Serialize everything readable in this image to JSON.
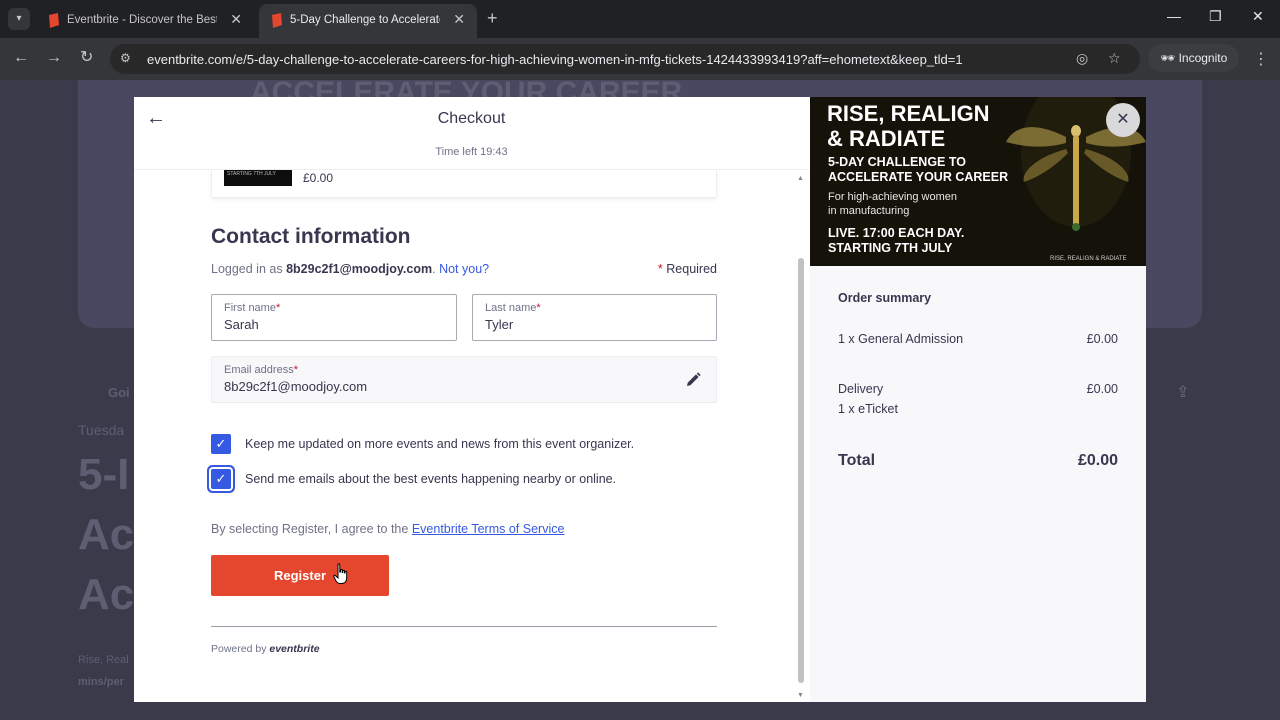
{
  "browser": {
    "tabs": [
      {
        "title": "Eventbrite - Discover the Best L",
        "active": false
      },
      {
        "title": "5-Day Challenge to Accelerate",
        "active": true
      }
    ],
    "url": "eventbrite.com/e/5-day-challenge-to-accelerate-careers-for-high-achieving-women-in-mfg-tickets-1424433993419?aff=ehometext&keep_tld=1",
    "incognito_label": "Incognito"
  },
  "background": {
    "hero_text": "ACCELERATE YOUR CAREER",
    "going_fast": "Goi",
    "date_fragment": "Tuesda",
    "title_lines": [
      "5-I",
      "Ac",
      "Ac"
    ],
    "desc_lines": [
      "Rise, Real",
      "mins/per"
    ]
  },
  "checkout": {
    "title": "Checkout",
    "timer": "Time left 19:43",
    "ticket_thumb_text": "STARTING 7TH JULY",
    "ticket_price": "£0.00",
    "contact_title": "Contact information",
    "logged_in_prefix": "Logged in as",
    "logged_in_email": "8b29c2f1@moodjoy.com",
    "not_you": "Not you?",
    "required": "Required",
    "first_name_label": "First name",
    "first_name_value": "Sarah",
    "last_name_label": "Last name",
    "last_name_value": "Tyler",
    "email_label": "Email address",
    "email_value": "8b29c2f1@moodjoy.com",
    "checkbox_1": "Keep me updated on more events and news from this event organizer.",
    "checkbox_2": "Send me emails about the best events happening nearby or online.",
    "terms_prefix": "By selecting Register, I agree to the",
    "terms_link": "Eventbrite Terms of Service",
    "register": "Register",
    "powered_by": "Powered by",
    "powered_brand": "eventbrite"
  },
  "banner": {
    "line1": "RISE, REALIGN",
    "line2": "& RADIATE",
    "line3": "5-DAY CHALLENGE TO",
    "line4": "ACCELERATE YOUR CAREER",
    "line5": "For high-achieving women",
    "line6": "in manufacturing",
    "line7": "LIVE. 17:00 EACH DAY.",
    "line8": "STARTING 7TH JULY",
    "brand_small": "RISE, REALIGN & RADIATE"
  },
  "summary": {
    "title": "Order summary",
    "item_label": "1 x General Admission",
    "item_amount": "£0.00",
    "delivery_label": "Delivery",
    "delivery_amount": "£0.00",
    "delivery_sub": "1 x eTicket",
    "total_label": "Total",
    "total_amount": "£0.00"
  },
  "colors": {
    "accent": "#3659e3",
    "register": "#e4472d"
  }
}
